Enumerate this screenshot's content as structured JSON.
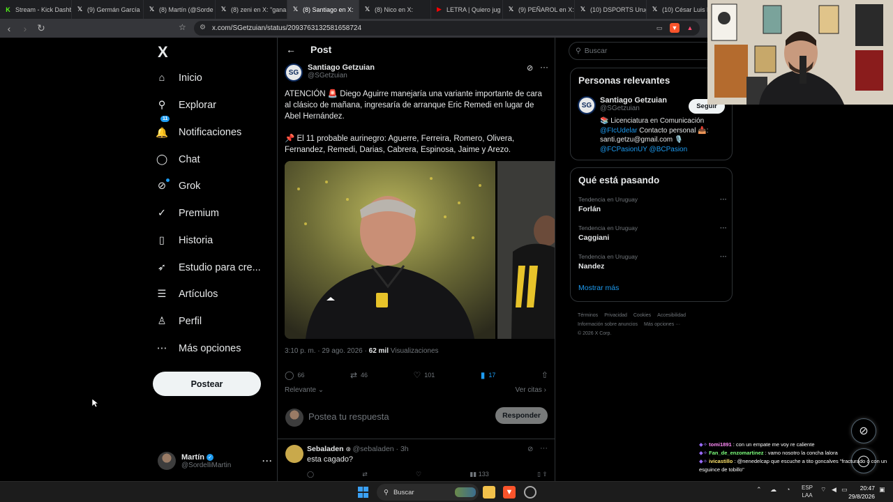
{
  "browser": {
    "tabs": [
      {
        "label": "Stream - Kick Dashboard",
        "icon": "kick-icon",
        "color": "#53fc18"
      },
      {
        "label": "(9) Germán García",
        "icon": "x-icon",
        "color": "#ffffff"
      },
      {
        "label": "(8) Martín (@Sorde",
        "icon": "x-icon",
        "color": "#ffffff"
      },
      {
        "label": "(8) zeni en X: \"gana",
        "icon": "x-icon",
        "color": "#ffffff"
      },
      {
        "label": "(8) Santiago en X:",
        "icon": "x-icon",
        "color": "#ffffff"
      },
      {
        "label": "(8) Nico en X:",
        "icon": "x-icon",
        "color": "#ffffff"
      },
      {
        "label": "LETRA | Quiero jug",
        "icon": "youtube-icon",
        "color": "#ff0000"
      },
      {
        "label": "(9) PEÑAROL en X:",
        "icon": "x-icon",
        "color": "#ffffff"
      },
      {
        "label": "(10) DSPORTS Urug",
        "icon": "x-icon",
        "color": "#ffffff"
      },
      {
        "label": "(10) César Luis Me",
        "icon": "x-icon",
        "color": "#ffffff"
      }
    ],
    "url": "x.com/SGetzuian/status/2093763132581658724"
  },
  "nav": {
    "logo": "X",
    "items": [
      {
        "label": "Inicio",
        "icon": "home-icon",
        "glyph": "⌂"
      },
      {
        "label": "Explorar",
        "icon": "search-icon",
        "glyph": "⚲"
      },
      {
        "label": "Notificaciones",
        "icon": "bell-icon",
        "glyph": "🔔",
        "badge": "11"
      },
      {
        "label": "Chat",
        "icon": "chat-icon",
        "glyph": "◯"
      },
      {
        "label": "Grok",
        "icon": "grok-icon",
        "glyph": "⊘"
      },
      {
        "label": "Premium",
        "icon": "premium-icon",
        "glyph": "✓"
      },
      {
        "label": "Historia",
        "icon": "bookmark-icon",
        "glyph": "▯"
      },
      {
        "label": "Estudio para cre...",
        "icon": "rocket-icon",
        "glyph": "➶"
      },
      {
        "label": "Artículos",
        "icon": "articles-icon",
        "glyph": "☰"
      },
      {
        "label": "Perfil",
        "icon": "profile-icon",
        "glyph": "♙"
      },
      {
        "label": "Más opciones",
        "icon": "more-icon",
        "glyph": "⋯"
      }
    ],
    "post_button": "Postear",
    "account": {
      "name": "Martín",
      "handle": "@SordelliMartin"
    }
  },
  "post": {
    "header_title": "Post",
    "author_name": "Santiago Getzuian",
    "author_handle": "@SGetzuian",
    "avatar_text": "SG",
    "text": "ATENCIÓN 🚨 Diego Aguirre manejaría una variante importante de cara al clásico de mañana, ingresaría de arranque Eric Remedi en lugar de Abel Hernández.\n\n📌 El 11 probable aurinegro: Aguerre, Ferreira, Romero, Olivera, Fernandez, Remedi, Darias, Cabrera, Espinosa, Jaime y Arezo.",
    "time": "3:10 p. m. · 29 ago. 2026 · ",
    "views_value": "62 mil",
    "views_label": " Visualizaciones",
    "replies": "66",
    "reposts": "46",
    "likes": "101",
    "bookmarks": "17",
    "relevance": "Relevante",
    "quotes_link": "Ver citas ›",
    "reply_placeholder": "Postea tu respuesta",
    "reply_button": "Responder"
  },
  "comment": {
    "name": "Sebaladen",
    "handle": "@sebaladen · 3h",
    "text": "esta cagado?",
    "views": "133"
  },
  "sidebar": {
    "search_placeholder": "Buscar",
    "relevant_title": "Personas relevantes",
    "rel_name": "Santiago Getzuian",
    "rel_handle": "@SGetzuian",
    "follow": "Seguir",
    "bio_line1": "📚 Licenciatura en Comunicación",
    "bio_link1": "@FIcUdelar",
    "bio_line2": " Contacto personal 📥:",
    "bio_line3": "santi.getzu@gmail.com 🎙️",
    "bio_link2": "@FCPasionUY @BCPasion",
    "trends_title": "Qué está pasando",
    "trends": [
      {
        "label": "Tendencia en Uruguay",
        "name": "Forlán"
      },
      {
        "label": "Tendencia en Uruguay",
        "name": "Caggiani"
      },
      {
        "label": "Tendencia en Uruguay",
        "name": "Nandez"
      }
    ],
    "show_more": "Mostrar más",
    "footer": [
      "Términos",
      "Privacidad",
      "Cookies",
      "Accesibilidad",
      "Información sobre anuncios",
      "Más opciones ···",
      "© 2026 X Corp."
    ]
  },
  "chat": [
    {
      "user": "tomi1891",
      "msg": " : con un empate me voy re caliente",
      "color": "#ff8af8"
    },
    {
      "user": "Fan_de_enzomartinez",
      "msg": " : vamo nosotro la concha lalora",
      "color": "#7cff7c"
    },
    {
      "user": "ivicastillo",
      "msg": " : @nenedelcap que escuche a tito goncalves \"fracturado o con un esguince de tobillo\"",
      "color": "#ffe46b"
    }
  ],
  "taskbar": {
    "search": "Buscar",
    "lang1": "ESP",
    "lang2": "LAA",
    "time": "20:47",
    "date": "29/8/2026"
  }
}
